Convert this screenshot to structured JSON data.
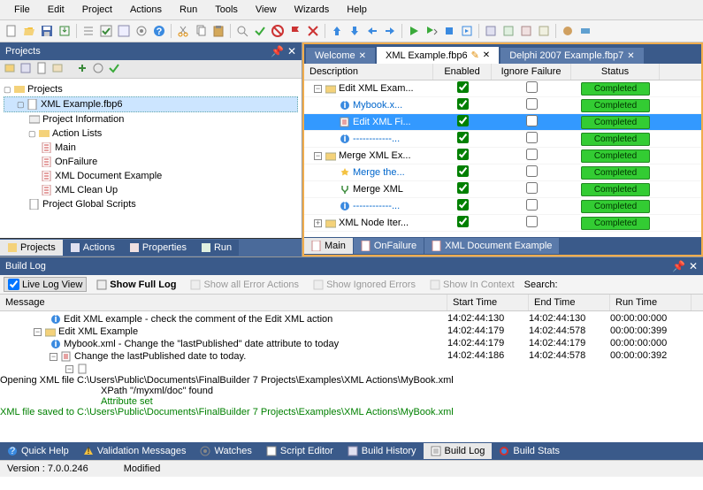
{
  "menu": [
    "File",
    "Edit",
    "Project",
    "Actions",
    "Run",
    "Tools",
    "View",
    "Wizards",
    "Help"
  ],
  "panels": {
    "projects": "Projects",
    "buildlog": "Build Log"
  },
  "tree": {
    "root": "Projects",
    "file": "XML Example.fbp6",
    "info": "Project Information",
    "actions": "Action Lists",
    "main": "Main",
    "onfail": "OnFailure",
    "doc": "XML Document Example",
    "clean": "XML Clean Up",
    "global": "Project Global Scripts"
  },
  "leftTabs": [
    "Projects",
    "Actions",
    "Properties",
    "Run"
  ],
  "docTabs": [
    {
      "label": "Welcome",
      "active": false
    },
    {
      "label": "XML Example.fbp6",
      "active": true
    },
    {
      "label": "Delphi 2007 Example.fbp7",
      "active": false
    }
  ],
  "gridCols": [
    "Description",
    "Enabled",
    "Ignore Failure",
    "Status"
  ],
  "gridRows": [
    {
      "indent": 0,
      "exp": "-",
      "icon": "folder",
      "desc": "Edit XML Exam...",
      "link": false,
      "enabled": true,
      "ignore": false,
      "status": "Completed",
      "sel": false
    },
    {
      "indent": 1,
      "exp": "",
      "icon": "info",
      "desc": "Mybook.x...",
      "link": true,
      "enabled": true,
      "ignore": false,
      "status": "Completed",
      "sel": false
    },
    {
      "indent": 1,
      "exp": "",
      "icon": "edit",
      "desc": "Edit XML Fi...",
      "link": false,
      "enabled": true,
      "ignore": false,
      "status": "Completed",
      "sel": true
    },
    {
      "indent": 1,
      "exp": "",
      "icon": "info",
      "desc": "------------...",
      "link": true,
      "enabled": true,
      "ignore": false,
      "status": "Completed",
      "sel": false
    },
    {
      "indent": 0,
      "exp": "-",
      "icon": "folder",
      "desc": "Merge XML Ex...",
      "link": false,
      "enabled": true,
      "ignore": false,
      "status": "Completed",
      "sel": false
    },
    {
      "indent": 1,
      "exp": "",
      "icon": "star",
      "desc": "Merge the...",
      "link": true,
      "enabled": true,
      "ignore": false,
      "status": "Completed",
      "sel": false
    },
    {
      "indent": 1,
      "exp": "",
      "icon": "merge",
      "desc": "Merge XML",
      "link": false,
      "enabled": true,
      "ignore": false,
      "status": "Completed",
      "sel": false
    },
    {
      "indent": 1,
      "exp": "",
      "icon": "info",
      "desc": "------------...",
      "link": true,
      "enabled": true,
      "ignore": false,
      "status": "Completed",
      "sel": false
    },
    {
      "indent": 0,
      "exp": "+",
      "icon": "folder",
      "desc": "XML Node Iter...",
      "link": false,
      "enabled": true,
      "ignore": false,
      "status": "Completed",
      "sel": false
    }
  ],
  "bottomTabs": [
    "Main",
    "OnFailure",
    "XML Document Example"
  ],
  "logToolbar": {
    "live": "Live Log View",
    "full": "Show Full Log",
    "errors": "Show all Error Actions",
    "ignored": "Show Ignored Errors",
    "context": "Show In Context",
    "search": "Search:"
  },
  "logCols": [
    "Message",
    "Start Time",
    "End Time",
    "Run Time"
  ],
  "logRows": [
    {
      "indent": 2,
      "exp": "",
      "icon": "info",
      "text": "Edit XML example - check the comment of the Edit XML action",
      "start": "14:02:44:130",
      "end": "14:02:44:130",
      "run": "00:00:00:000"
    },
    {
      "indent": 1,
      "exp": "-",
      "icon": "folder",
      "text": "Edit XML Example",
      "start": "14:02:44:179",
      "end": "14:02:44:578",
      "run": "00:00:00:399"
    },
    {
      "indent": 2,
      "exp": "",
      "icon": "info",
      "text": "Mybook.xml - Change the \"lastPublished\" date attribute to today",
      "start": "14:02:44:179",
      "end": "14:02:44:179",
      "run": "00:00:00:000"
    },
    {
      "indent": 2,
      "exp": "-",
      "icon": "edit",
      "text": "Change the lastPublished date to today.",
      "start": "14:02:44:186",
      "end": "14:02:44:578",
      "run": "00:00:00:392"
    },
    {
      "indent": 3,
      "exp": "-",
      "icon": "doc",
      "text": "",
      "start": "",
      "end": "",
      "run": ""
    }
  ],
  "logDetail": [
    "Opening XML file C:\\Users\\Public\\Documents\\FinalBuilder 7 Projects\\Examples\\XML Actions\\MyBook.xml",
    "XPath \"/myxml/doc\" found",
    "Attribute set",
    "XML file saved to C:\\Users\\Public\\Documents\\FinalBuilder 7 Projects\\Examples\\XML Actions\\MyBook.xml"
  ],
  "footerTabs": [
    "Quick Help",
    "Validation Messages",
    "Watches",
    "Script Editor",
    "Build History",
    "Build Log",
    "Build Stats"
  ],
  "status": {
    "version": "Version :  7.0.0.246",
    "modified": "Modified"
  }
}
